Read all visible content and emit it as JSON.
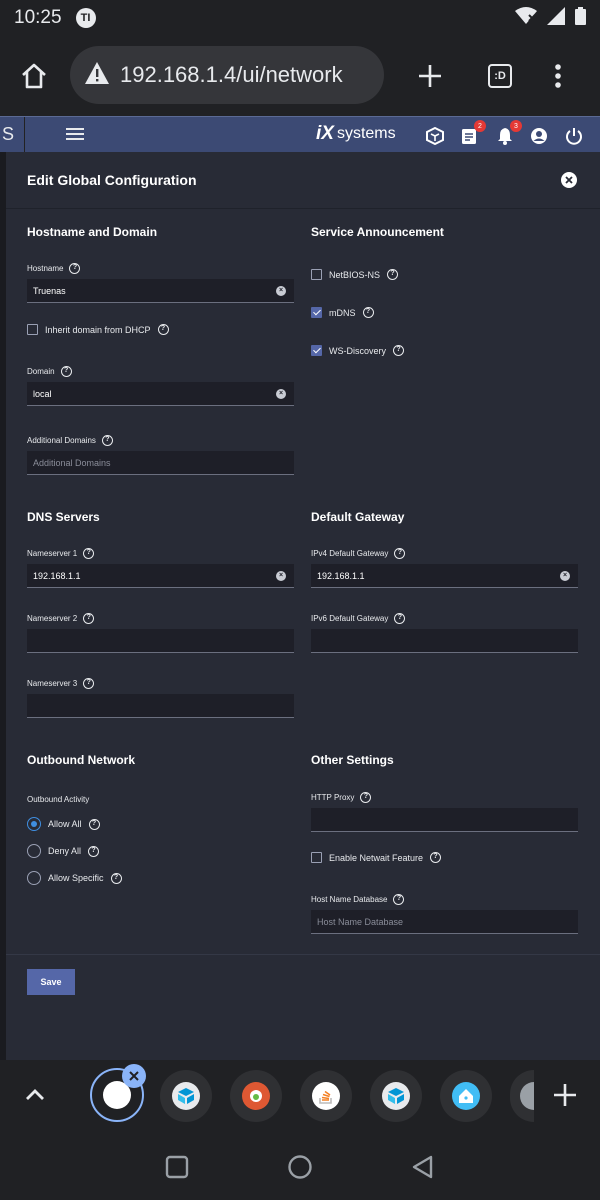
{
  "status_bar": {
    "time": "10:25",
    "app_icon_label": "TI"
  },
  "browser": {
    "url": "192.168.1.4/ui/network",
    "tab_count_label": ":D"
  },
  "topbar": {
    "left_letter": "S",
    "logo_mark": "iX",
    "logo_text": "systems",
    "tasks_badge": "2",
    "alerts_badge": "3"
  },
  "dialog": {
    "title": "Edit Global Configuration",
    "hostname_domain": {
      "title": "Hostname and Domain",
      "hostname_label": "Hostname",
      "hostname_value": "Truenas",
      "inherit_label": "Inherit domain from DHCP",
      "inherit_checked": false,
      "domain_label": "Domain",
      "domain_value": "local",
      "additional_label": "Additional Domains",
      "additional_placeholder": "Additional Domains"
    },
    "service_announcement": {
      "title": "Service Announcement",
      "items": [
        {
          "label": "NetBIOS-NS",
          "checked": false
        },
        {
          "label": "mDNS",
          "checked": true
        },
        {
          "label": "WS-Discovery",
          "checked": true
        }
      ]
    },
    "dns": {
      "title": "DNS Servers",
      "ns1_label": "Nameserver 1",
      "ns1_value": "192.168.1.1",
      "ns2_label": "Nameserver 2",
      "ns2_value": "",
      "ns3_label": "Nameserver 3",
      "ns3_value": ""
    },
    "gateway": {
      "title": "Default Gateway",
      "ipv4_label": "IPv4 Default Gateway",
      "ipv4_value": "192.168.1.1",
      "ipv6_label": "IPv6 Default Gateway",
      "ipv6_value": ""
    },
    "outbound": {
      "title": "Outbound Network",
      "activity_label": "Outbound Activity",
      "options": [
        {
          "label": "Allow All",
          "selected": true
        },
        {
          "label": "Deny All",
          "selected": false
        },
        {
          "label": "Allow Specific",
          "selected": false
        }
      ]
    },
    "other": {
      "title": "Other Settings",
      "proxy_label": "HTTP Proxy",
      "proxy_value": "",
      "netwait_label": "Enable Netwait Feature",
      "netwait_checked": false,
      "hostdb_label": "Host Name Database",
      "hostdb_placeholder": "Host Name Database"
    },
    "save_label": "Save"
  },
  "colors": {
    "topbar": "#3c4a74",
    "card": "#282b36",
    "input": "#1e1f28",
    "accent": "#5567a8",
    "radio_accent": "#3f8ee0"
  }
}
